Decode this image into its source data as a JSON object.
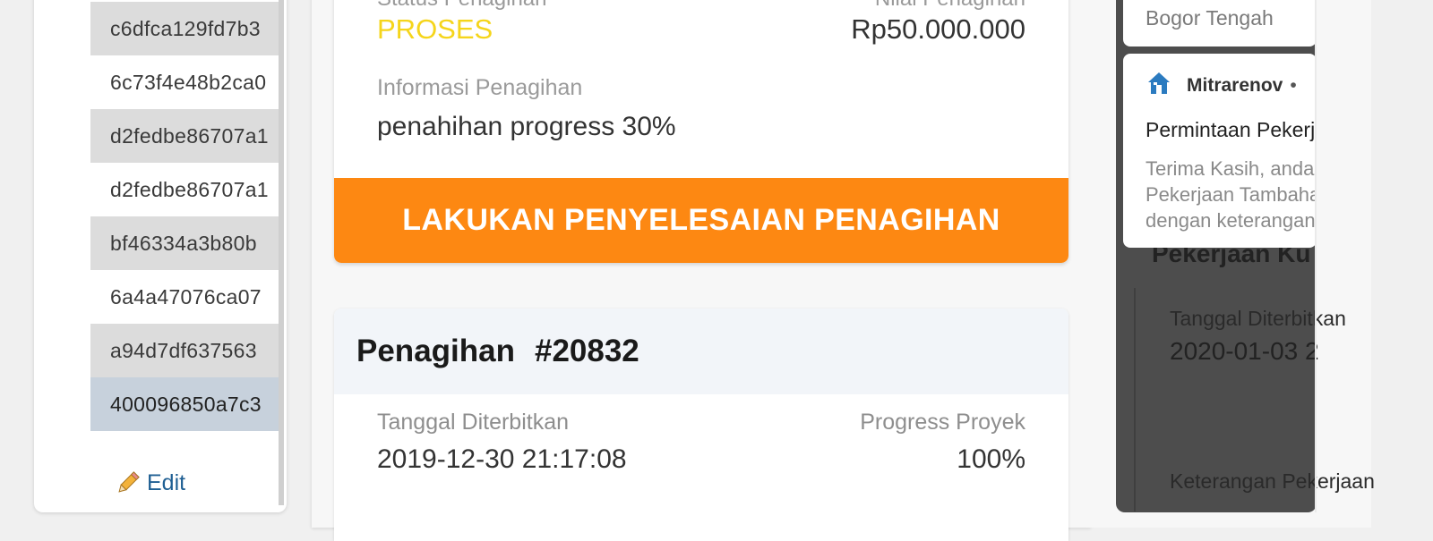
{
  "left": {
    "hashes": [
      "c6dfca129fd7b3",
      "6c73f4e48b2ca0",
      "d2fedbe86707a1",
      "d2fedbe86707a1",
      "bf46334a3b80b",
      "6a4a47076ca07",
      "a94d7df637563",
      "400096850a7c3"
    ],
    "edit_label": "Edit"
  },
  "middle": {
    "card1": {
      "status_label": "Status Penagihan",
      "status_value": "PROSES",
      "amount_label": "Nilai Penagihan",
      "amount_value": "Rp50.000.000",
      "info_label": "Informasi Penagihan",
      "info_value": "penahihan progress 30%",
      "cta_label": "LAKUKAN PENYELESAIAN PENAGIHAN"
    },
    "card2": {
      "title": "Penagihan",
      "number": "#20832",
      "date_label": "Tanggal Diterbitkan",
      "date_value": "2019-12-30 21:17:08",
      "progress_label": "Progress Proyek",
      "progress_value": "100%"
    }
  },
  "right": {
    "top_notif_text": "Bogor Tengah",
    "notif": {
      "app_name": "Mitrarenov",
      "separator": "•",
      "title": "Permintaan Pekerjaan",
      "body_line1": "Terima Kasih, anda",
      "body_line2": "Pekerjaan Tambahan",
      "body_line3": "dengan keterangan"
    },
    "bg": {
      "heading": "Pekerjaan Ku",
      "date_label": "Tanggal Diterbitkan",
      "date_value": "2020-01-03 2",
      "desc_label": "Keterangan Pekerjaan"
    }
  },
  "colors": {
    "accent_orange": "#fd8812",
    "status_yellow": "#f5d51b",
    "link_blue": "#1f5f93"
  }
}
